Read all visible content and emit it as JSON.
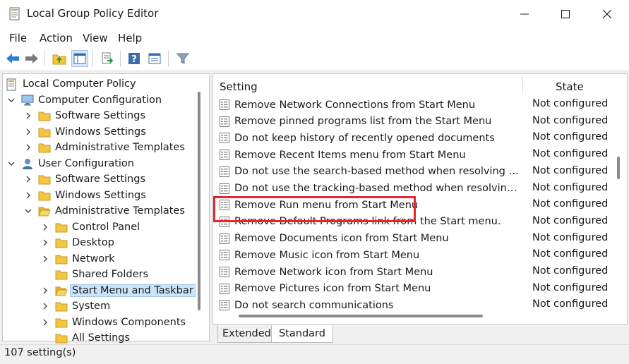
{
  "window": {
    "title": "Local Group Policy Editor",
    "icon": "policy-doc-icon"
  },
  "menu": [
    "File",
    "Action",
    "View",
    "Help"
  ],
  "toolbar": {
    "icons": [
      "back-arrow-icon",
      "forward-arrow-icon",
      "up-folder-icon",
      "show-hide-tree-icon",
      "export-list-icon",
      "help-icon",
      "properties-icon",
      "filter-icon"
    ]
  },
  "tree": {
    "root": "Local Computer Policy",
    "items": [
      {
        "label": "Computer Configuration",
        "chev": "down",
        "icon": "computer"
      },
      {
        "label": "Software Settings",
        "chev": "right",
        "icon": "folder"
      },
      {
        "label": "Windows Settings",
        "chev": "right",
        "icon": "folder"
      },
      {
        "label": "Administrative Templates",
        "chev": "right",
        "icon": "folder"
      },
      {
        "label": "User Configuration",
        "chev": "down",
        "icon": "user"
      },
      {
        "label": "Software Settings",
        "chev": "right",
        "icon": "folder"
      },
      {
        "label": "Windows Settings",
        "chev": "right",
        "icon": "folder"
      },
      {
        "label": "Administrative Templates",
        "chev": "down",
        "icon": "folder-open"
      },
      {
        "label": "Control Panel",
        "chev": "right",
        "icon": "folder"
      },
      {
        "label": "Desktop",
        "chev": "right",
        "icon": "folder"
      },
      {
        "label": "Network",
        "chev": "right",
        "icon": "folder"
      },
      {
        "label": "Shared Folders",
        "chev": "",
        "icon": "folder"
      },
      {
        "label": "Start Menu and Taskbar",
        "chev": "right",
        "icon": "folder-open",
        "selected": true
      },
      {
        "label": "System",
        "chev": "right",
        "icon": "folder"
      },
      {
        "label": "Windows Components",
        "chev": "right",
        "icon": "folder"
      },
      {
        "label": "All Settings",
        "chev": "",
        "icon": "folder"
      }
    ]
  },
  "list": {
    "col_setting": "Setting",
    "col_state": "State",
    "rows": [
      {
        "name": "Remove Network Connections from Start Menu",
        "state": "Not configured"
      },
      {
        "name": "Remove pinned programs list from the Start Menu",
        "state": "Not configured"
      },
      {
        "name": "Do not keep history of recently opened documents",
        "state": "Not configured"
      },
      {
        "name": "Remove Recent Items menu from Start Menu",
        "state": "Not configured"
      },
      {
        "name": "Do not use the search-based method when resolving shell sh...",
        "state": "Not configured"
      },
      {
        "name": "Do not use the tracking-based method when resolving shell ...",
        "state": "Not configured"
      },
      {
        "name": "Remove Run menu from Start Menu",
        "state": "Not configured",
        "highlighted": true
      },
      {
        "name": "Remove Default Programs link from the Start menu.",
        "state": "Not configured"
      },
      {
        "name": "Remove Documents icon from Start Menu",
        "state": "Not configured"
      },
      {
        "name": "Remove Music icon from Start Menu",
        "state": "Not configured"
      },
      {
        "name": "Remove Network icon from Start Menu",
        "state": "Not configured"
      },
      {
        "name": "Remove Pictures icon from Start Menu",
        "state": "Not configured"
      },
      {
        "name": "Do not search communications",
        "state": "Not configured"
      }
    ]
  },
  "tabs": [
    "Extended",
    "Standard"
  ],
  "active_tab": "Standard",
  "status": "107 setting(s)",
  "colors": {
    "highlight_box": "#e5262a",
    "selection": "#cce4f7",
    "folder": "#f4c542"
  }
}
